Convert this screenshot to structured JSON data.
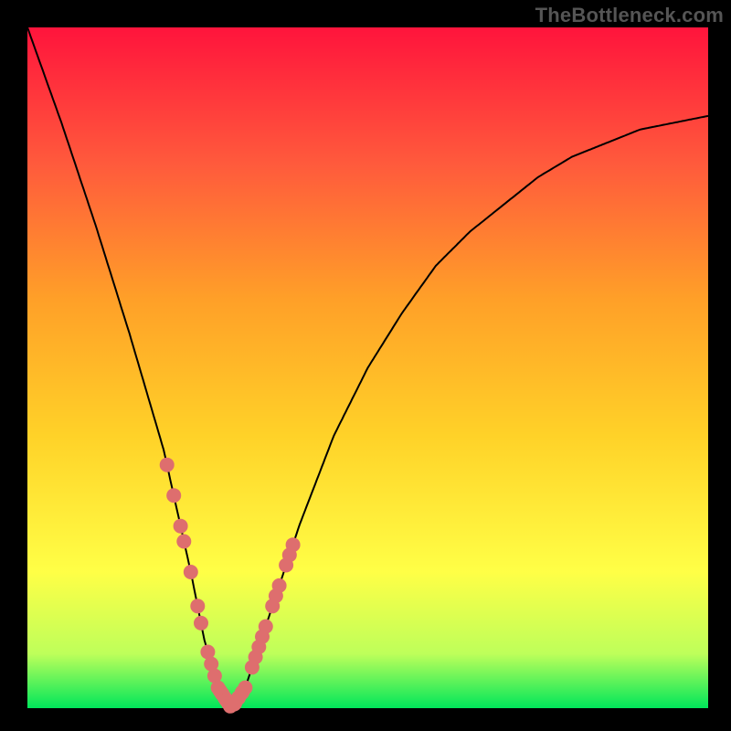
{
  "watermark": "TheBottleneck.com",
  "chart_data": {
    "type": "line",
    "title": "",
    "xlabel": "",
    "ylabel": "",
    "xlim": [
      0,
      100
    ],
    "ylim": [
      0,
      100
    ],
    "grid": false,
    "background": "red-to-green vertical gradient",
    "series": [
      {
        "name": "bottleneck-curve",
        "x": [
          0,
          5,
          10,
          15,
          20,
          24,
          26,
          28,
          30,
          32,
          35,
          40,
          45,
          50,
          55,
          60,
          65,
          70,
          75,
          80,
          85,
          90,
          95,
          100
        ],
        "values": [
          100,
          86,
          71,
          55,
          38,
          20,
          10,
          3,
          0,
          3,
          12,
          27,
          40,
          50,
          58,
          65,
          70,
          74,
          78,
          81,
          83,
          85,
          86,
          87
        ]
      }
    ],
    "markers": [
      {
        "name": "left-branch-dots",
        "x": [
          20.5,
          21.5,
          22.5,
          23.0,
          24.0,
          25.0,
          25.5,
          26.5,
          27.0,
          27.5,
          28.0,
          28.3,
          28.6,
          29.0,
          29.5
        ],
        "y_from": "curve"
      },
      {
        "name": "right-branch-dots",
        "x": [
          30.5,
          31.0,
          31.5,
          32.0,
          33.0,
          33.5,
          34.0,
          34.5,
          35.0,
          36.0,
          36.5,
          37.0,
          38.0,
          38.5,
          39.0
        ],
        "y_from": "curve"
      },
      {
        "name": "valley-dots",
        "x": [
          28.6,
          29.2,
          29.8,
          30.4,
          31.0,
          31.6
        ],
        "y_from": "curve"
      }
    ],
    "annotations": []
  }
}
